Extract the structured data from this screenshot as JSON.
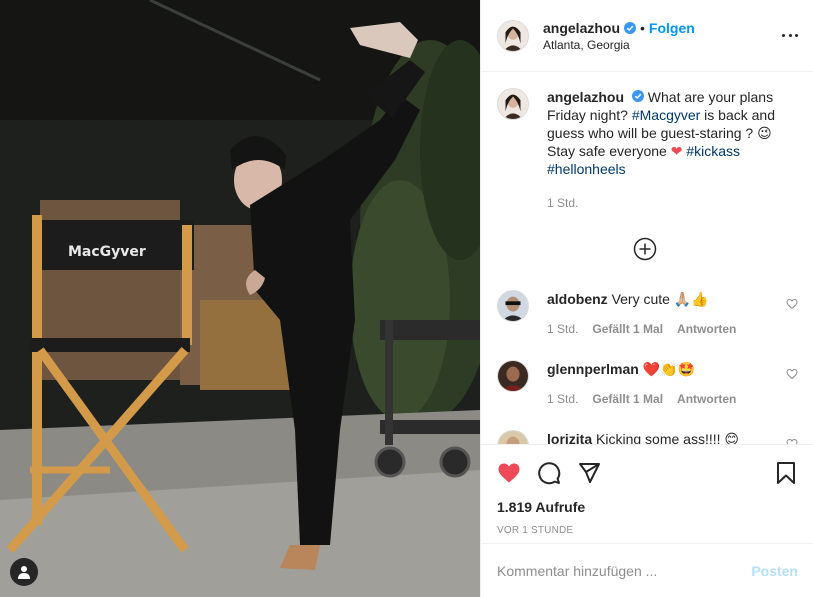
{
  "post": {
    "username": "angelazhou",
    "follow_label": "Folgen",
    "location": "Atlanta, Georgia",
    "dot": "•"
  },
  "caption": {
    "username": "angelazhou",
    "text_1": " What are your plans Friday night? ",
    "tag_1": "#Macgyver",
    "text_2": " is back and guess who will be guest-staring ? ",
    "emoji_1": "😉",
    "text_3": " Stay safe everyone ",
    "emoji_heart": "❤",
    "tag_2": "#kickass",
    "tag_3": "#hellonheels",
    "time": "1 Std."
  },
  "comments": [
    {
      "username": "aldobenz",
      "text": "Very cute 🙏🏼👍",
      "time": "1 Std.",
      "likes": "Gefällt 1 Mal",
      "reply": "Antworten"
    },
    {
      "username": "glennperlman",
      "text": "❤️👏🤩",
      "time": "1 Std.",
      "likes": "Gefällt 1 Mal",
      "reply": "Antworten"
    },
    {
      "username": "lorizita",
      "text": "Kicking some ass!!!! 😊"
    }
  ],
  "stats": {
    "views": "1.819 Aufrufe",
    "ago": "VOR 1 STUNDE"
  },
  "add_comment": {
    "placeholder": "Kommentar hinzufügen ...",
    "post_label": "Posten"
  },
  "media": {
    "chair_label": "MacGyver"
  },
  "colors": {
    "like_red": "#ed4956",
    "link_blue": "#0095f6",
    "hashtag": "#00376b",
    "muted": "#8e8e8e"
  }
}
